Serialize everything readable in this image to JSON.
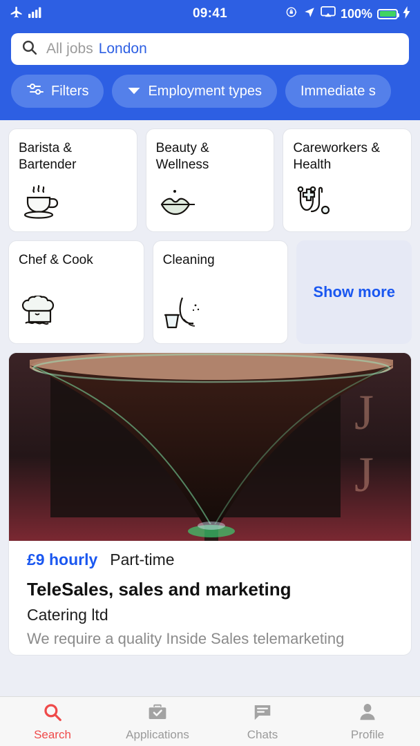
{
  "status_bar": {
    "airplane_icon": "airplane-mode-icon",
    "signal_icon": "cellular-signal-icon",
    "time": "09:41",
    "rotation_lock_icon": "rotation-lock-icon",
    "location_icon": "location-arrow-icon",
    "airplay_icon": "screen-mirroring-icon",
    "battery_percent": "100%",
    "battery_icon": "battery-icon",
    "charging_icon": "charging-bolt-icon",
    "bar_color": "#2d5fe3",
    "battery_fill_color": "#41d361"
  },
  "search": {
    "icon": "search-icon",
    "category_value": "All jobs",
    "location_value": "London",
    "location_color": "#2d5fe3"
  },
  "filters": {
    "chips": [
      {
        "label": "Filters",
        "icon": "sliders-icon"
      },
      {
        "label": "Employment types",
        "icon": "chevron-down-icon"
      },
      {
        "label": "Immediate s",
        "icon": "none"
      }
    ]
  },
  "categories": {
    "row1": [
      {
        "title": "Barista & Bartender",
        "icon": "coffee-cup-icon"
      },
      {
        "title": "Beauty & Wellness",
        "icon": "lips-icon"
      },
      {
        "title": "Careworkers & Health",
        "icon": "stethoscope-icon"
      }
    ],
    "row2": [
      {
        "title": "Chef & Cook",
        "icon": "chef-hat-icon"
      },
      {
        "title": "Cleaning",
        "icon": "bucket-mop-icon"
      }
    ],
    "show_more_label": "Show more",
    "show_more_color": "#1a57f0"
  },
  "job_card": {
    "photo_alt": "espresso-martini-cocktail-photo",
    "pay": "£9 hourly",
    "employment_type": "Part-time",
    "title": "TeleSales, sales and marketing",
    "company": "Catering  ltd",
    "description": "We require a quality Inside Sales telemarketing",
    "pay_color": "#1a57f0"
  },
  "tabbar": {
    "items": [
      {
        "label": "Search",
        "icon": "search-icon",
        "active": true
      },
      {
        "label": "Applications",
        "icon": "briefcase-check-icon",
        "active": false
      },
      {
        "label": "Chats",
        "icon": "chat-bubble-icon",
        "active": false
      },
      {
        "label": "Profile",
        "icon": "person-icon",
        "active": false
      }
    ],
    "active_color": "#ef4a4a",
    "inactive_color": "#9a9a9a"
  }
}
